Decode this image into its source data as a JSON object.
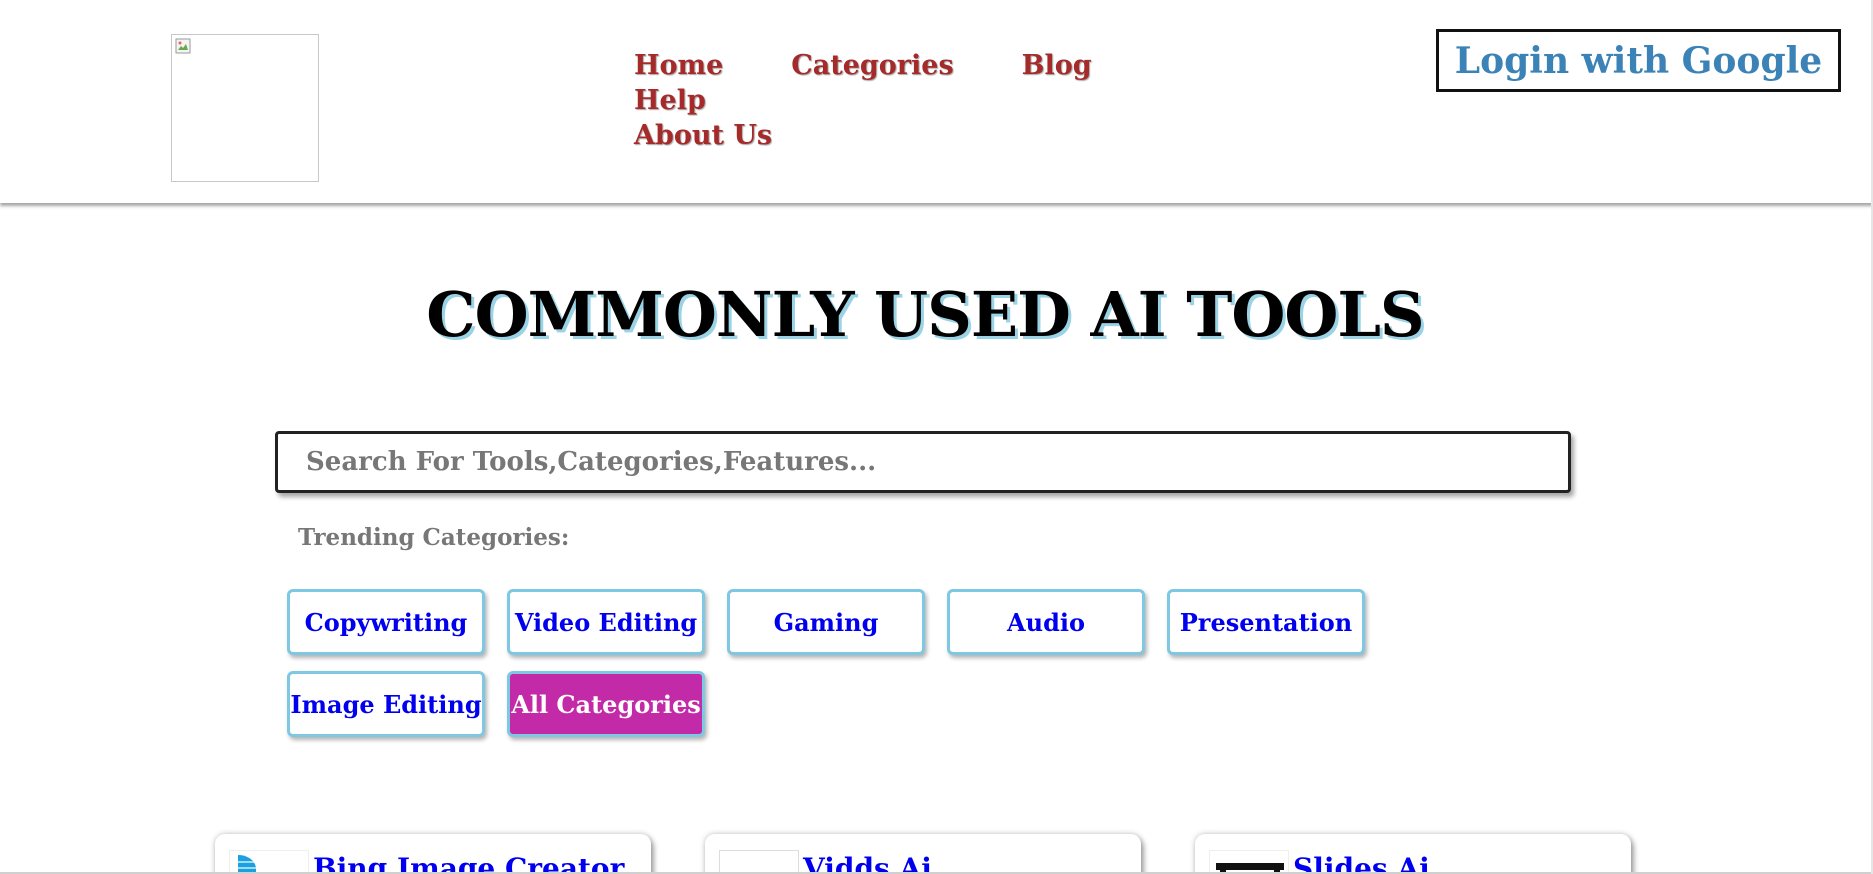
{
  "header": {
    "logo_alt": "",
    "nav": [
      {
        "label": "Home"
      },
      {
        "label": "Categories"
      },
      {
        "label": "Blog"
      },
      {
        "label": "Help"
      },
      {
        "label": "About Us"
      }
    ],
    "login_label": "Login with Google"
  },
  "main": {
    "title": "COMMONLY USED AI TOOLS",
    "search": {
      "placeholder": "Search For Tools,Categories,Features...",
      "value": ""
    },
    "trending_label": "Trending Categories:",
    "categories": [
      {
        "label": "Copywriting"
      },
      {
        "label": "Video Editing"
      },
      {
        "label": "Gaming"
      },
      {
        "label": "Audio"
      },
      {
        "label": "Presentation"
      },
      {
        "label": "Image Editing"
      },
      {
        "label": "All Categories",
        "active": true
      }
    ],
    "tools": [
      {
        "name": "Bing Image Creator",
        "icon": "bing-icon"
      },
      {
        "name": "Vidds Ai",
        "icon": "image-placeholder-icon"
      },
      {
        "name": "Slides Ai",
        "icon": "slides-icon"
      }
    ]
  },
  "colors": {
    "nav_text": "#a52a2a",
    "login_text": "#3b82b6",
    "link_blue": "#0000ee",
    "active_category_bg": "#c22aa8",
    "category_border": "#7fc8e3",
    "title_shadow": "#9ad3e6"
  }
}
